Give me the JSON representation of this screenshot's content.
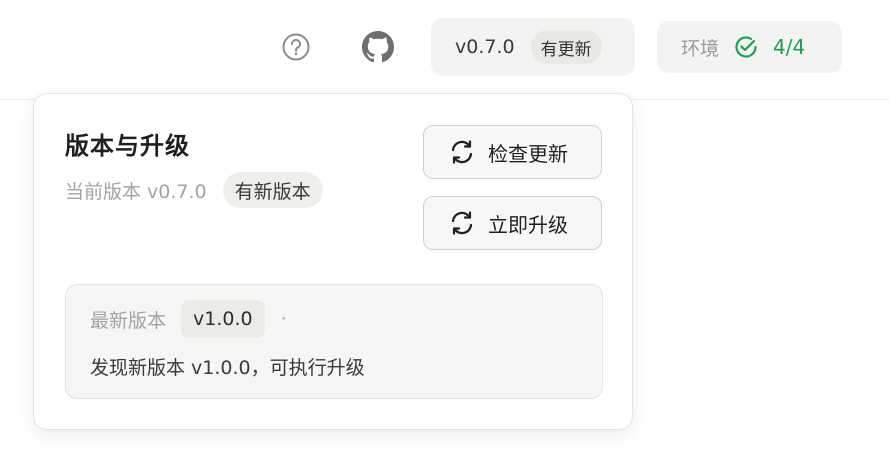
{
  "header": {
    "help_icon": "question-circle-icon",
    "github_icon": "github-icon",
    "version": "v0.7.0",
    "update_badge": "有更新",
    "env_label": "环境",
    "env_status_icon": "check-circle-icon",
    "env_count": "4/4",
    "env_color": "#1f9d55"
  },
  "popover": {
    "title": "版本与升级",
    "current_version": "当前版本 v0.7.0",
    "new_version_badge": "有新版本",
    "check_button": "检查更新",
    "upgrade_button": "立即升级",
    "latest_label": "最新版本",
    "latest_version": "v1.0.0",
    "separator": "·",
    "message": "发现新版本 v1.0.0，可执行升级"
  }
}
